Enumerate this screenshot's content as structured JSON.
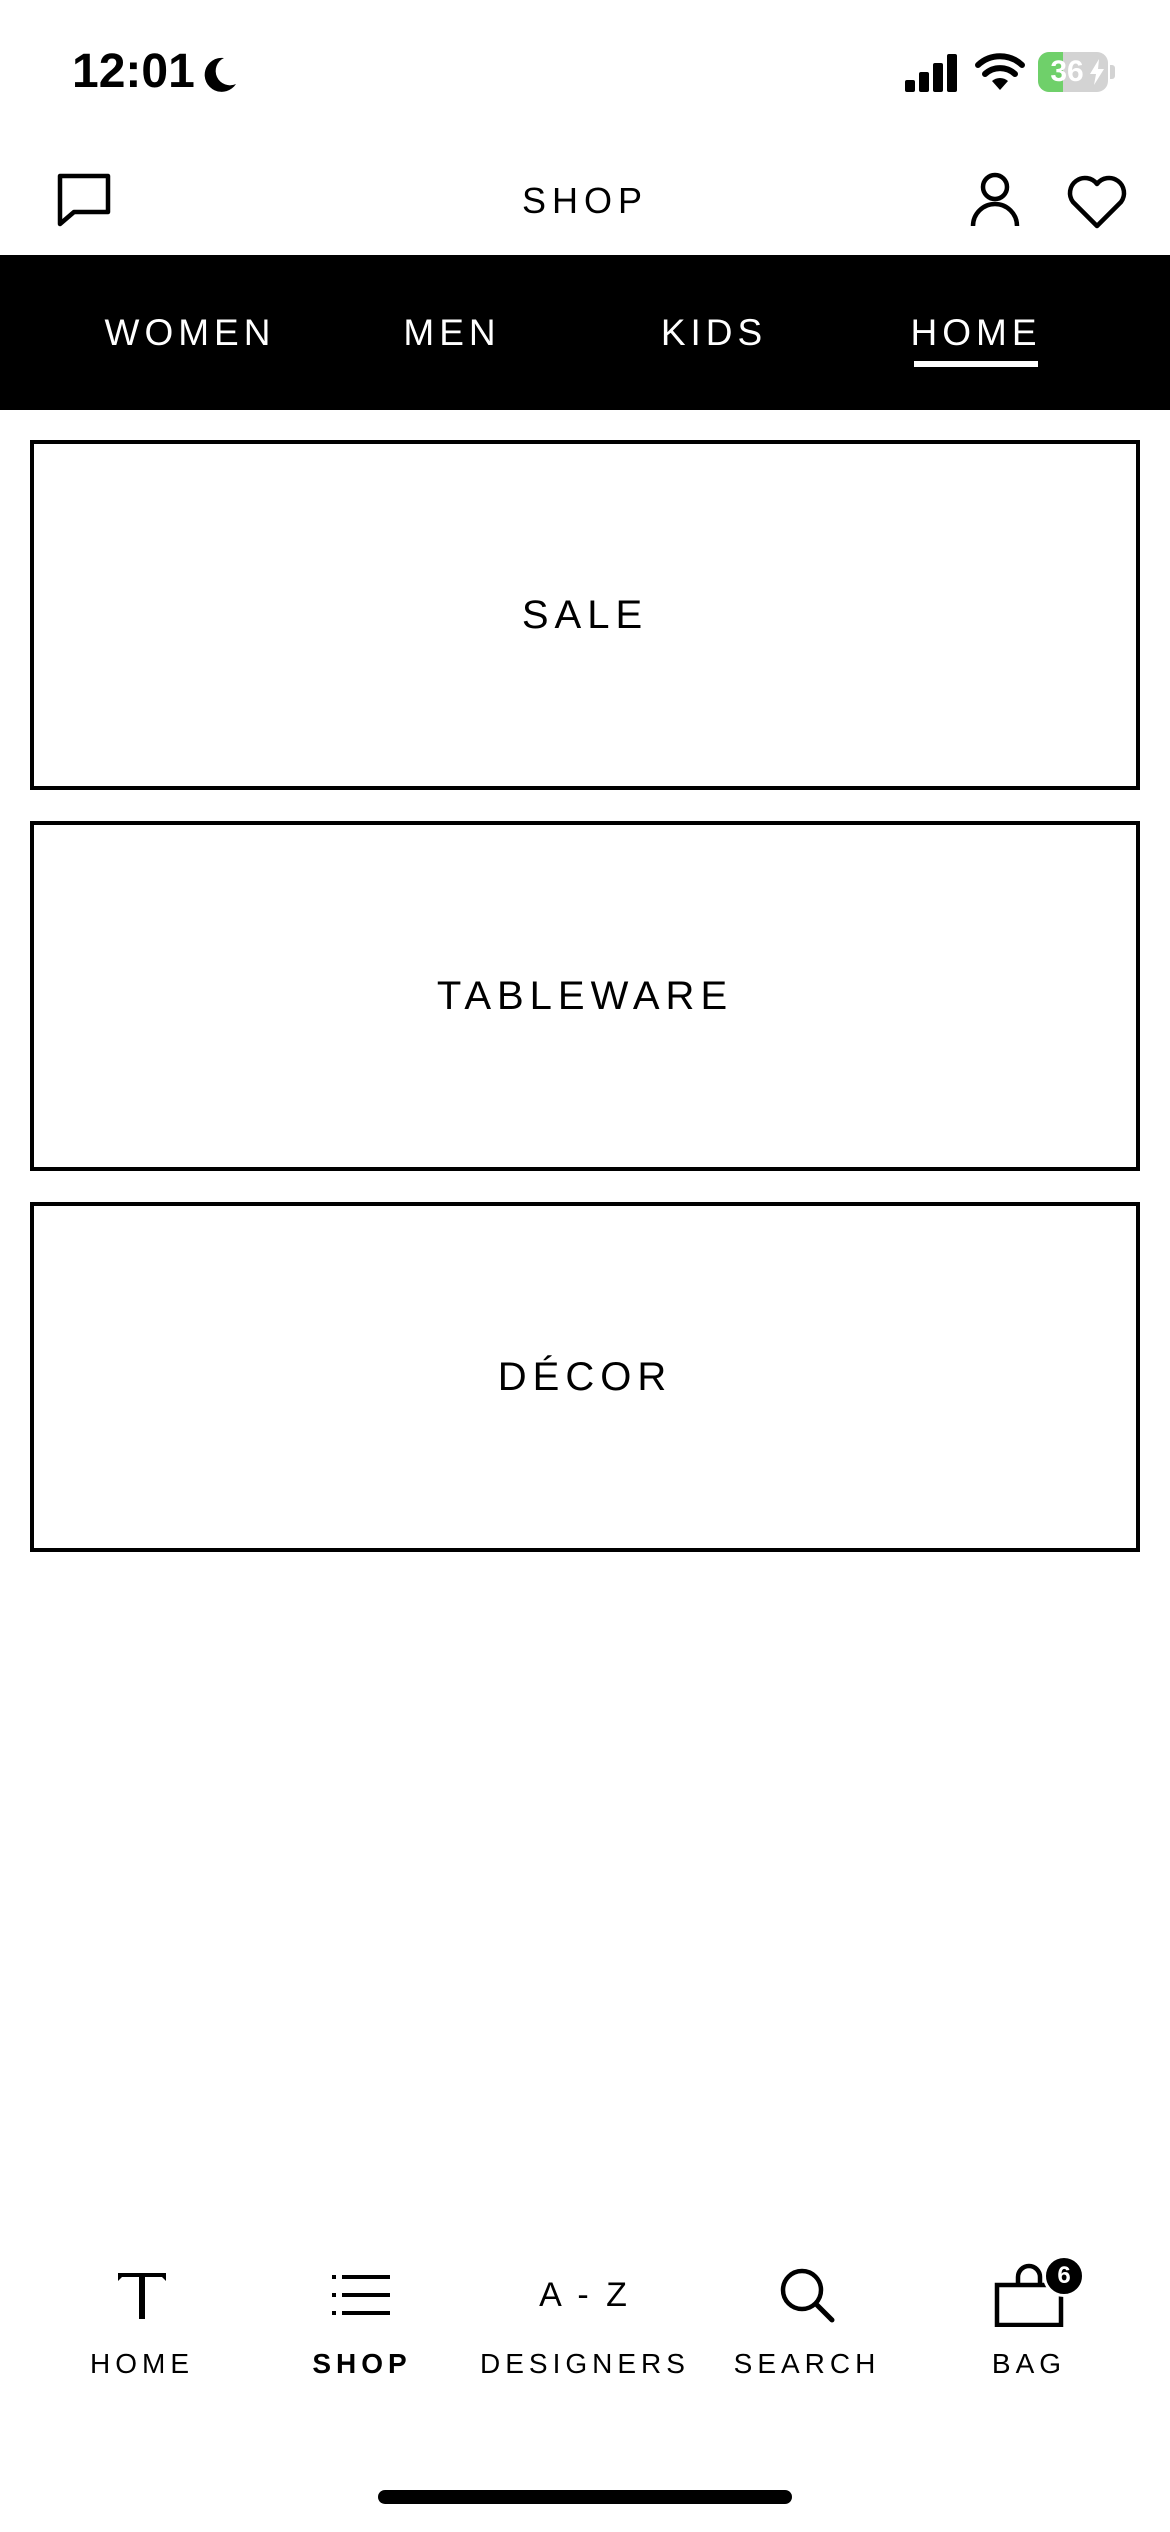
{
  "status_bar": {
    "time": "12:01",
    "battery_percent": "36",
    "battery_level": 0.36,
    "battery_color": "#6fd06a"
  },
  "header": {
    "title": "SHOP"
  },
  "tabs": [
    {
      "label": "WOMEN",
      "active": false
    },
    {
      "label": "MEN",
      "active": false
    },
    {
      "label": "KIDS",
      "active": false
    },
    {
      "label": "HOME",
      "active": true
    }
  ],
  "categories": [
    {
      "label": "SALE"
    },
    {
      "label": "TABLEWARE"
    },
    {
      "label": "DÉCOR"
    }
  ],
  "bottom_nav": {
    "home_label": "HOME",
    "shop_label": "SHOP",
    "designers_label": "DESIGNERS",
    "designers_icon_text": "A - Z",
    "search_label": "SEARCH",
    "bag_label": "BAG",
    "bag_count": "6",
    "active": "shop",
    "icons": {
      "home": "t-logo-icon",
      "shop": "list-icon",
      "search": "search-icon",
      "bag": "bag-icon"
    }
  },
  "colors": {
    "accent": "#000000",
    "background": "#ffffff"
  }
}
